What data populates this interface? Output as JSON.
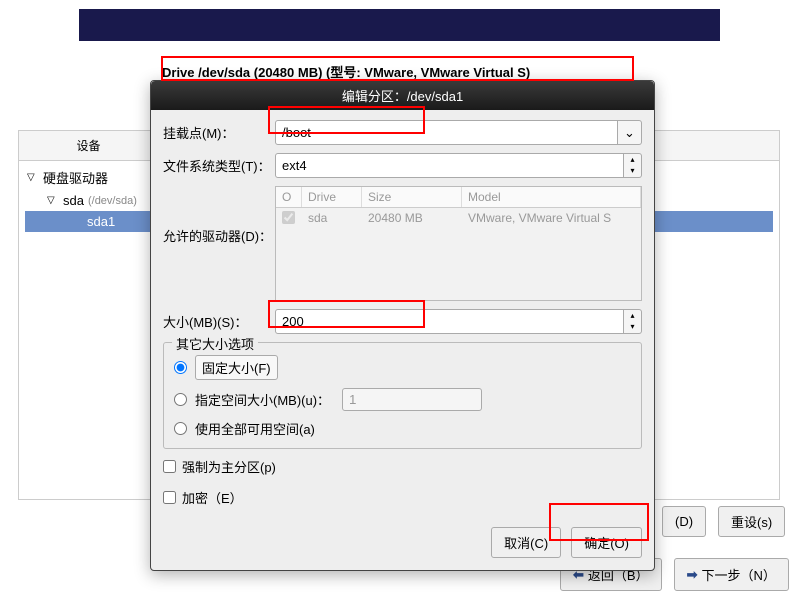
{
  "top_banner": {},
  "drive_info_label": "Drive /dev/sda (20480 MB) (型号: VMware, VMware Virtual S)",
  "device_panel": {
    "header_device": "设备",
    "tree": {
      "root": "硬盘驱动器",
      "sda_label": "sda",
      "sda_path": "(/dev/sda)",
      "sda1_label": "sda1"
    }
  },
  "buttons": {
    "delete": "(D)",
    "reset": "重设(s)",
    "back": "返回（B）",
    "next": "下一步（N）"
  },
  "modal": {
    "title": "编辑分区：/dev/sda1",
    "labels": {
      "mount_point": "挂载点(M)：",
      "fs_type": "文件系统类型(T)：",
      "allowed_drives": "允许的驱动器(D)：",
      "size_mb": "大小(MB)(S)："
    },
    "values": {
      "mount_point": "/boot",
      "fs_type": "ext4",
      "size_mb": "200"
    },
    "drives_table": {
      "headers": {
        "check": "O",
        "drive": "Drive",
        "size": "Size",
        "model": "Model"
      },
      "row": {
        "checked": true,
        "drive": "sda",
        "size": "20480 MB",
        "model": "VMware, VMware Virtual S"
      }
    },
    "fieldset": {
      "legend": "其它大小选项",
      "fixed": "固定大小(F)",
      "fill_to": "指定空间大小(MB)(u)：",
      "fill_to_value": "1",
      "fill_max": "使用全部可用空间(a)"
    },
    "checks": {
      "primary": "强制为主分区(p)",
      "encrypt": "加密（E）"
    },
    "btn_cancel": "取消(C)",
    "btn_ok": "确定(O)"
  }
}
